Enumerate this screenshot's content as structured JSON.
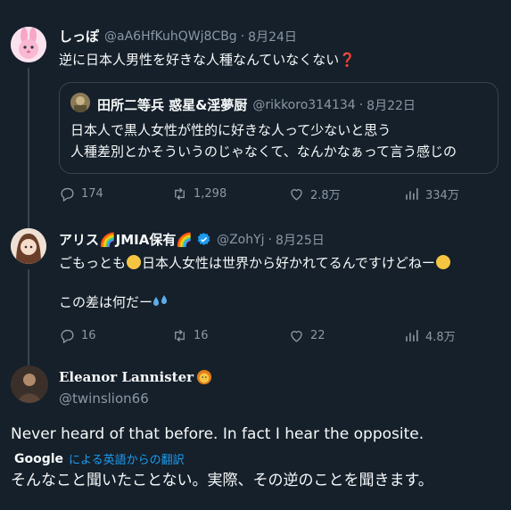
{
  "tweet1": {
    "name": "しっぽ",
    "handle": "@aA6HfKuhQWj8CBg",
    "date": "8月24日",
    "text": "逆に日本人男性を好きな人種なんていなくない❓",
    "quote": {
      "name": "田所二等兵 惑星&淫夢厨",
      "handle": "@rikkoro314134",
      "date": "8月22日",
      "line1": "日本人で黒人女性が性的に好きな人って少ないと思う",
      "line2": "人種差別とかそういうのじゃなくて、なんかなぁって言う感じの"
    },
    "stats": {
      "replies": "174",
      "retweets": "1,298",
      "likes": "2.8万",
      "views": "334万"
    }
  },
  "tweet2": {
    "name": "アリス🌈JMIA保有🌈",
    "handle": "@ZohYj",
    "date": "8月25日",
    "line1a": "ごもっとも",
    "line1b": "日本人女性は世界から好かれてるんですけどねー",
    "line2": "この差は何だー",
    "stats": {
      "replies": "16",
      "retweets": "16",
      "likes": "22",
      "views": "4.8万"
    }
  },
  "tweet3": {
    "name": "Eleanor Lannister",
    "handle": "@twinslion66",
    "text": "Never heard of that before. In fact I hear the opposite.",
    "translate_brand": "Google",
    "translate_label": "による英語からの翻訳",
    "translation": "そんなこと聞いたことない。実際、その逆のことを聞きます。"
  },
  "colors": {
    "background": "#15202b",
    "text": "#f7f9f9",
    "muted": "#8b98a5",
    "link": "#1d9bf0",
    "border": "#38444d"
  }
}
